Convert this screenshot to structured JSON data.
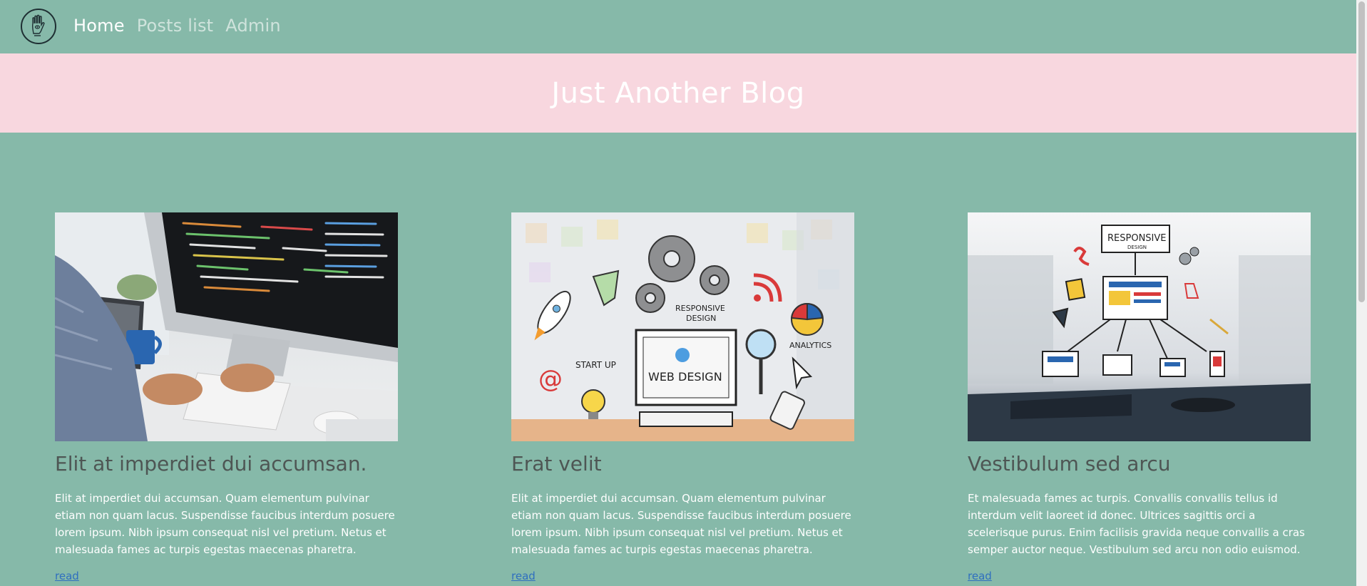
{
  "nav": {
    "logo_icon": "hand-logo-icon",
    "links": [
      {
        "label": "Home",
        "active": true
      },
      {
        "label": "Posts list",
        "active": false
      },
      {
        "label": "Admin",
        "active": false
      }
    ]
  },
  "hero": {
    "title": "Just Another Blog"
  },
  "posts": [
    {
      "title": "Elit at imperdiet dui accumsan.",
      "excerpt": "Elit at imperdiet dui accumsan. Quam elementum pulvinar etiam non quam lacus. Suspendisse faucibus interdum posuere lorem ipsum. Nibh ipsum consequat nisl vel pretium. Netus et malesuada fames ac turpis egestas maecenas pharetra. Malesuada…",
      "link_label": "read",
      "image": "person-coding-at-desktop-photo"
    },
    {
      "title": "Erat velit",
      "excerpt": "Elit at imperdiet dui accumsan. Quam elementum pulvinar etiam non quam lacus. Suspendisse faucibus interdum posuere lorem ipsum. Nibh ipsum consequat nisl vel pretium. Netus et malesuada fames ac turpis egestas maecenas pharetra. Malesuada…",
      "link_label": "read",
      "image": "web-design-doodle-illustration",
      "image_text": {
        "responsive": "RESPONSIVE",
        "design": "DESIGN",
        "web_design": "WEB DESIGN",
        "start_up": "START UP",
        "analytics": "ANALYTICS"
      }
    },
    {
      "title": "Vestibulum sed arcu",
      "excerpt": "Et malesuada fames ac turpis. Convallis convallis tellus id interdum velit laoreet id donec. Ultrices sagittis orci a scelerisque purus. Enim facilisis gravida neque convallis a cras semper auctor neque. Vestibulum sed arcu non odio euismod. Hac habitasse…",
      "link_label": "read",
      "image": "responsive-design-devices-illustration",
      "image_text": {
        "responsive": "RESPONSIVE",
        "design": "DESIGN"
      }
    }
  ],
  "colors": {
    "background": "#86b9a9",
    "hero_background": "#f8d7df",
    "title_text": "#4e5654",
    "link": "#2f6fbf"
  }
}
